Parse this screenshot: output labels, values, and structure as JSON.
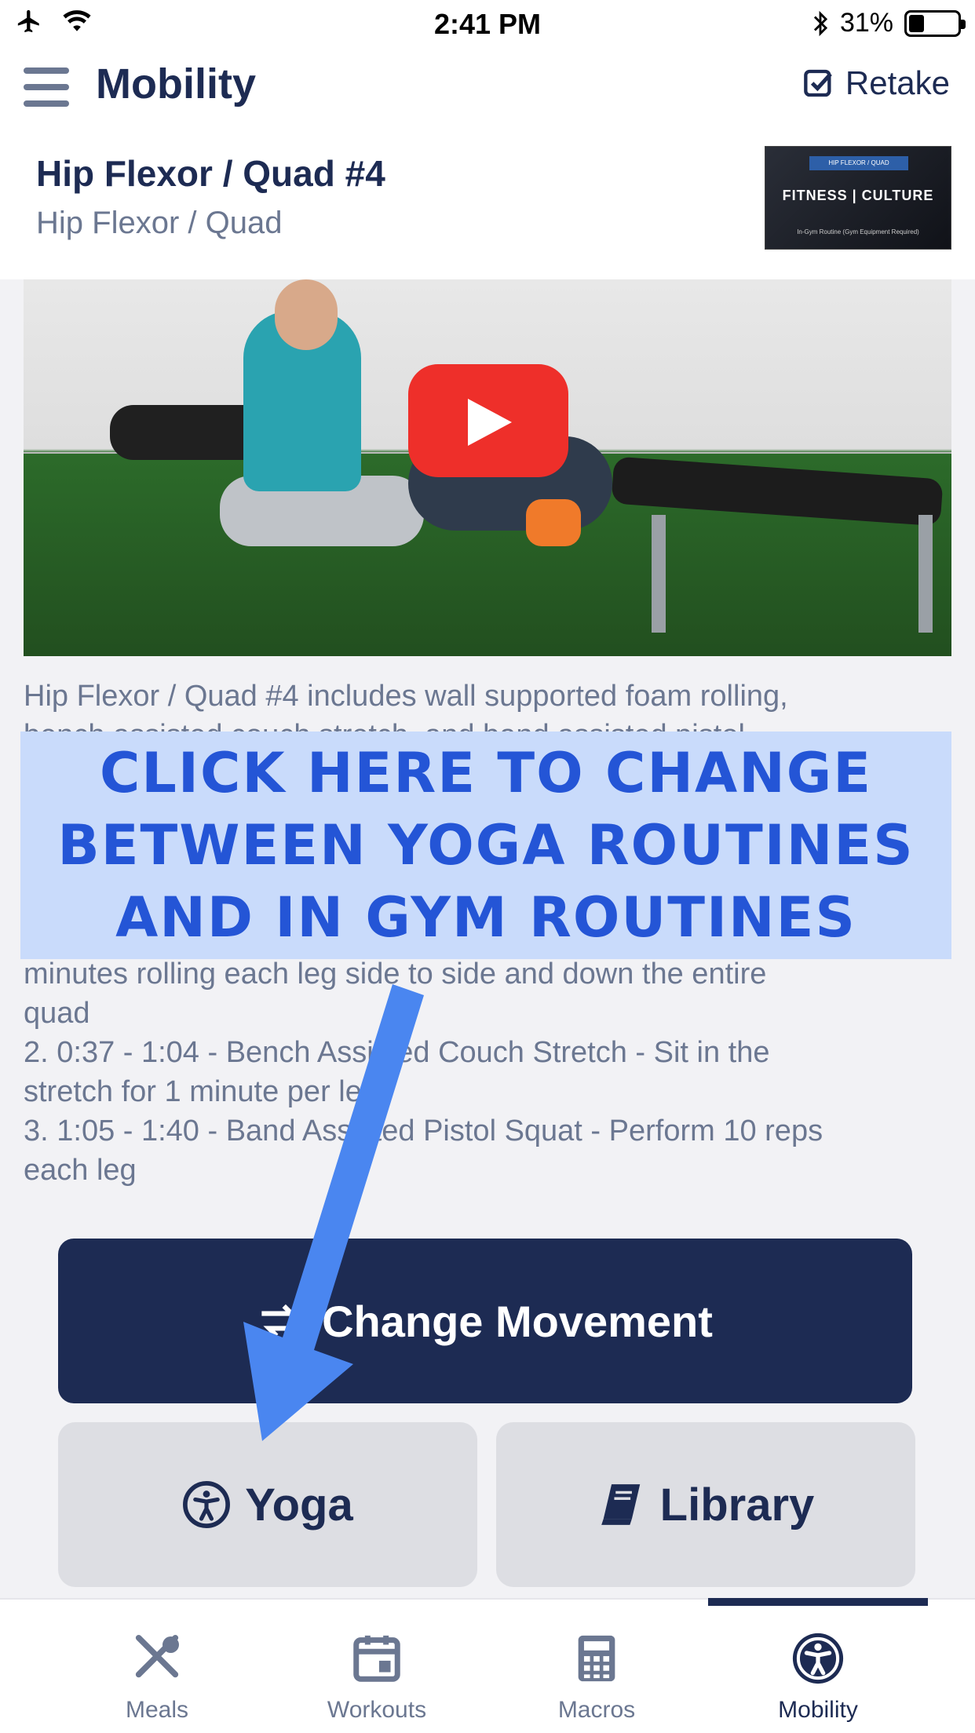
{
  "status_bar": {
    "time": "2:41 PM",
    "battery_percent": "31%",
    "battery_level": 0.31
  },
  "header": {
    "title": "Mobility",
    "retake_label": "Retake"
  },
  "exercise": {
    "title": "Hip Flexor / Quad #4",
    "subtitle": "Hip Flexor / Quad",
    "thumbnail": {
      "tag": "HIP FLEXOR / QUAD",
      "brand": "FITNESS | CULTURE",
      "note": "In-Gym Routine (Gym Equipment Required)"
    }
  },
  "description": {
    "line1": "Hip Flexor / Quad #4 includes wall supported foam rolling,",
    "line2": "bench assisted couch stretch, and band assisted pistol",
    "line3": "minutes rolling each leg side to side and down the entire",
    "line4": "quad",
    "line5": "2. 0:37 - 1:04 - Bench Assisted Couch Stretch - Sit in the",
    "line6": "stretch for 1 minute per leg",
    "line7": "3. 1:05 - 1:40 - Band Assisted Pistol Squat - Perform 10 reps",
    "line8": "each leg"
  },
  "overlay": {
    "line1": "CLICK HERE TO CHANGE",
    "line2": "BETWEEN YOGA ROUTINES",
    "line3": "AND IN GYM ROUTINES"
  },
  "actions": {
    "change_movement": "Change Movement",
    "yoga": "Yoga",
    "library": "Library"
  },
  "tabs": [
    {
      "label": "Meals",
      "icon": "utensils-icon",
      "active": false
    },
    {
      "label": "Workouts",
      "icon": "calendar-icon",
      "active": false
    },
    {
      "label": "Macros",
      "icon": "calculator-icon",
      "active": false
    },
    {
      "label": "Mobility",
      "icon": "accessibility-icon",
      "active": true
    }
  ],
  "colors": {
    "primary": "#1d2b53",
    "muted": "#6b7791",
    "overlay_bg": "#c9dbfb",
    "overlay_text": "#2455d6",
    "arrow": "#4a86f0",
    "youtube_red": "#ee2f2a"
  }
}
